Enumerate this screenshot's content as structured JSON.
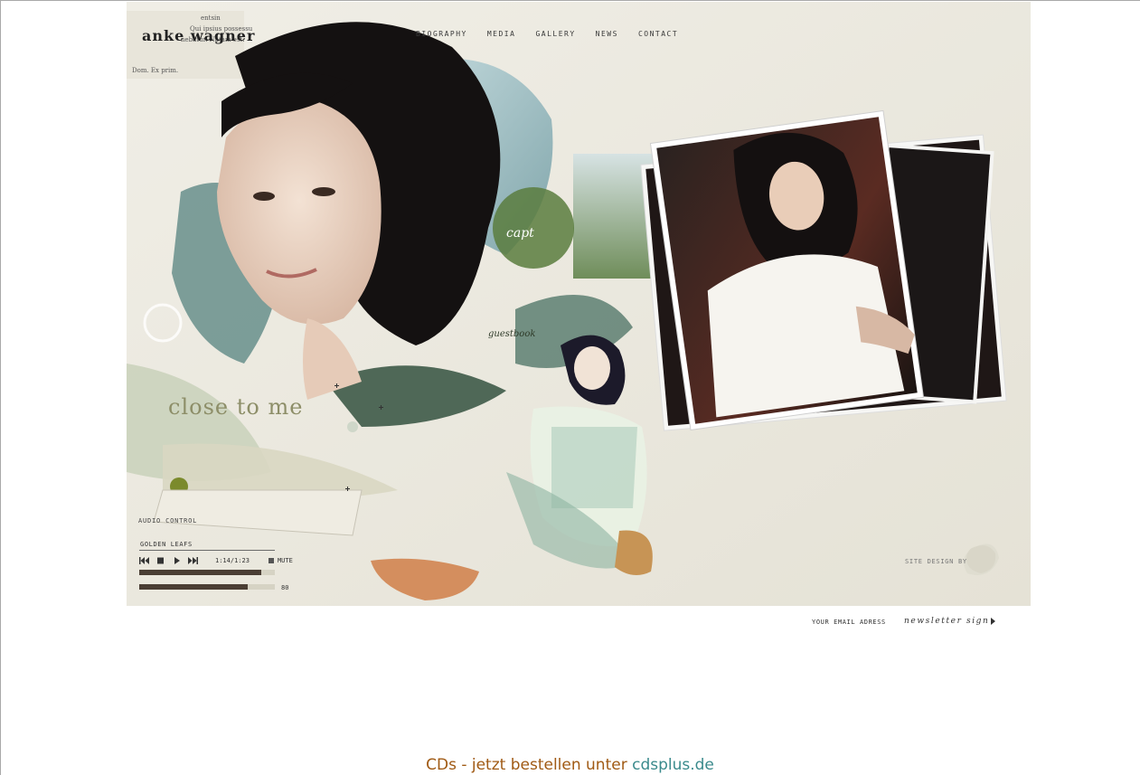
{
  "site": {
    "logo": "anke wagner"
  },
  "nav": {
    "items": [
      "BIOGRAPHY",
      "MEDIA",
      "GALLERY",
      "NEWS",
      "CONTACT"
    ]
  },
  "content": {
    "album_title": "close to me",
    "guestbook": "guestbook",
    "caption": "capt"
  },
  "audio": {
    "label": "AUDIO CONTROL",
    "track": "GOLDEN LEAFS",
    "time": "1:14/1:23",
    "mute": "MUTE",
    "progress_fraction": 0.9,
    "volume_value": "80",
    "volume_fraction": 0.8
  },
  "credits": {
    "site_design": "SITE DESIGN BY"
  },
  "newsletter": {
    "email_label": "YOUR EMAIL ADRESS",
    "sign_label": "newsletter sign"
  },
  "footer": {
    "text": "CDs - jetzt bestellen unter",
    "link": "cdsplus.de"
  },
  "colors": {
    "background": "#ebe9e0",
    "footer_text": "#a05a14",
    "footer_link": "#3a8a8c"
  }
}
